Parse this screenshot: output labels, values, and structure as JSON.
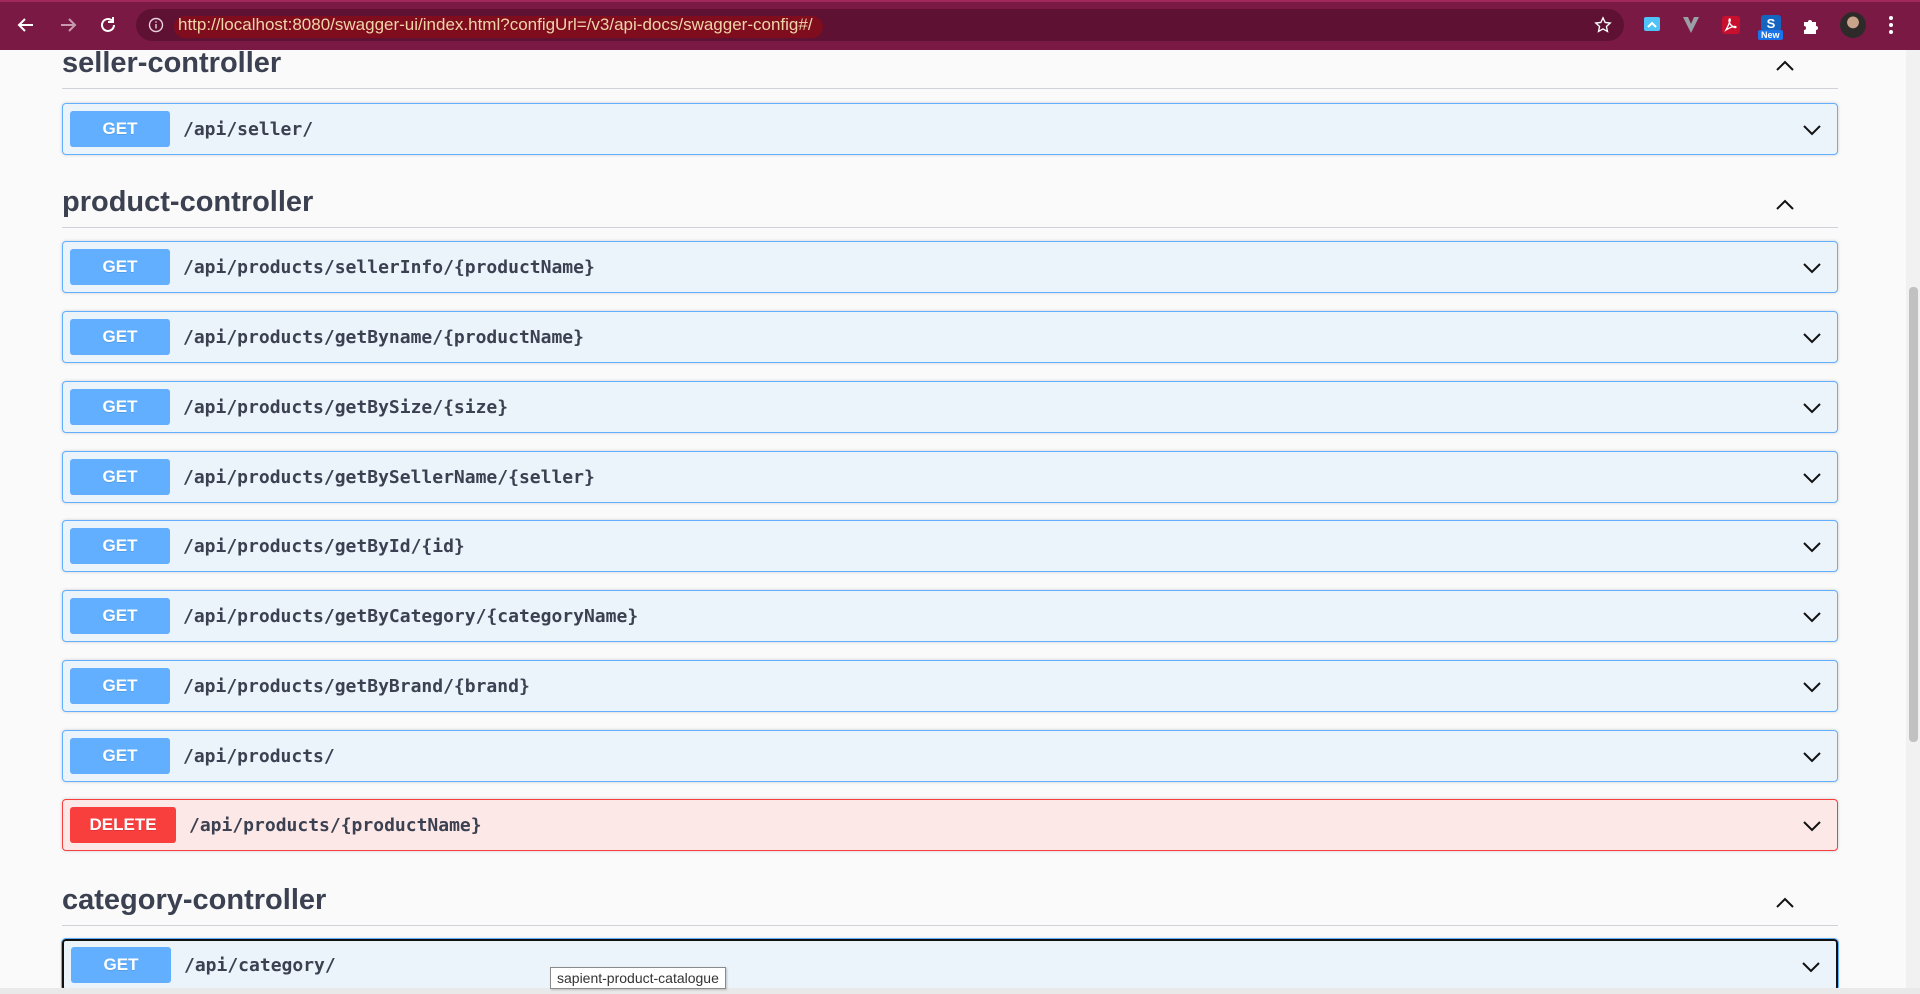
{
  "browser": {
    "url": "http://localhost:8080/swagger-ui/index.html?configUrl=/v3/api-docs/swagger-config#/",
    "new_badge": "New"
  },
  "sections": [
    {
      "title": "seller-controller",
      "operations": [
        {
          "method": "GET",
          "path": "/api/seller/"
        }
      ]
    },
    {
      "title": "product-controller",
      "operations": [
        {
          "method": "GET",
          "path": "/api/products/sellerInfo/{productName}"
        },
        {
          "method": "GET",
          "path": "/api/products/getByname/{productName}"
        },
        {
          "method": "GET",
          "path": "/api/products/getBySize/{size}"
        },
        {
          "method": "GET",
          "path": "/api/products/getBySellerName/{seller}"
        },
        {
          "method": "GET",
          "path": "/api/products/getById/{id}"
        },
        {
          "method": "GET",
          "path": "/api/products/getByCategory/{categoryName}"
        },
        {
          "method": "GET",
          "path": "/api/products/getByBrand/{brand}"
        },
        {
          "method": "GET",
          "path": "/api/products/"
        },
        {
          "method": "DELETE",
          "path": "/api/products/{productName}"
        }
      ]
    },
    {
      "title": "category-controller",
      "operations": [
        {
          "method": "GET",
          "path": "/api/category/"
        }
      ]
    }
  ],
  "tooltip": "sapient-product-catalogue",
  "colors": {
    "get": "#61affe",
    "delete": "#f93e3e",
    "toolbar": "#7a1a44"
  }
}
